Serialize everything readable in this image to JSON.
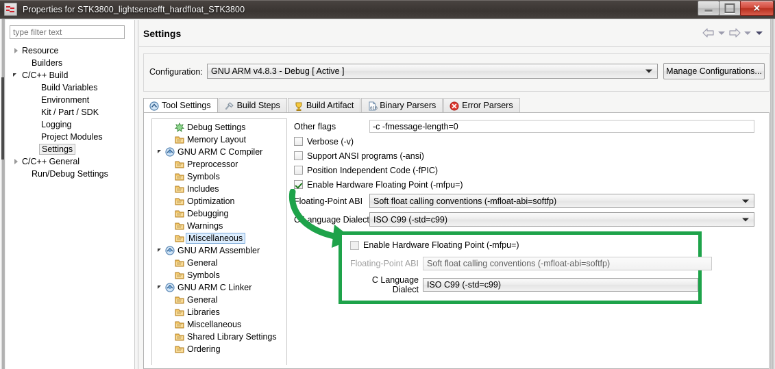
{
  "window": {
    "title": "Properties for STK3800_lightsensefft_hardfloat_STK3800",
    "app_icon": "simplicity-studio-icon",
    "minimize_label": "",
    "maximize_label": "",
    "close_label": "✕"
  },
  "sidebar": {
    "filter_placeholder": "type filter text",
    "filter_value": "",
    "items": [
      {
        "label": "Resource",
        "indent": 0,
        "twist": "collapsed",
        "selected": false
      },
      {
        "label": "Builders",
        "indent": 1,
        "twist": "none",
        "selected": false
      },
      {
        "label": "C/C++ Build",
        "indent": 0,
        "twist": "expanded",
        "selected": false
      },
      {
        "label": "Build Variables",
        "indent": 2,
        "twist": "none",
        "selected": false
      },
      {
        "label": "Environment",
        "indent": 2,
        "twist": "none",
        "selected": false
      },
      {
        "label": "Kit / Part / SDK",
        "indent": 2,
        "twist": "none",
        "selected": false
      },
      {
        "label": "Logging",
        "indent": 2,
        "twist": "none",
        "selected": false
      },
      {
        "label": "Project Modules",
        "indent": 2,
        "twist": "none",
        "selected": false
      },
      {
        "label": "Settings",
        "indent": 2,
        "twist": "none",
        "selected": true
      },
      {
        "label": "C/C++ General",
        "indent": 0,
        "twist": "collapsed",
        "selected": false
      },
      {
        "label": "Run/Debug Settings",
        "indent": 1,
        "twist": "none",
        "selected": false
      }
    ]
  },
  "content": {
    "page_title": "Settings",
    "nav": {
      "back_icon": "back-arrow-icon",
      "back_menu_icon": "chevron-down-icon",
      "forward_icon": "forward-arrow-icon",
      "forward_menu_icon": "chevron-down-icon",
      "view_menu_icon": "chevron-down-icon"
    },
    "configuration": {
      "label": "Configuration:",
      "value": "GNU ARM v4.8.3 - Debug  [ Active ]",
      "manage_button": "Manage Configurations..."
    },
    "tabs": [
      {
        "label": "Tool Settings",
        "icon": "tool-settings-icon",
        "active": true
      },
      {
        "label": "Build Steps",
        "icon": "build-steps-icon",
        "active": false
      },
      {
        "label": "Build Artifact",
        "icon": "build-artifact-icon",
        "active": false
      },
      {
        "label": "Binary Parsers",
        "icon": "binary-parsers-icon",
        "active": false
      },
      {
        "label": "Error Parsers",
        "icon": "error-parsers-icon",
        "active": false
      }
    ],
    "tool_tree": [
      {
        "label": "Debug Settings",
        "indent": 1,
        "twist": "none",
        "icon": "debug-icon",
        "selected": false
      },
      {
        "label": "Memory Layout",
        "indent": 1,
        "twist": "none",
        "icon": "folder-icon",
        "selected": false
      },
      {
        "label": "GNU ARM C Compiler",
        "indent": 0,
        "twist": "expanded",
        "icon": "tool-icon",
        "selected": false
      },
      {
        "label": "Preprocessor",
        "indent": 1,
        "twist": "none",
        "icon": "folder-icon",
        "selected": false
      },
      {
        "label": "Symbols",
        "indent": 1,
        "twist": "none",
        "icon": "folder-icon",
        "selected": false
      },
      {
        "label": "Includes",
        "indent": 1,
        "twist": "none",
        "icon": "folder-icon",
        "selected": false
      },
      {
        "label": "Optimization",
        "indent": 1,
        "twist": "none",
        "icon": "folder-icon",
        "selected": false
      },
      {
        "label": "Debugging",
        "indent": 1,
        "twist": "none",
        "icon": "folder-icon",
        "selected": false
      },
      {
        "label": "Warnings",
        "indent": 1,
        "twist": "none",
        "icon": "folder-icon",
        "selected": false
      },
      {
        "label": "Miscellaneous",
        "indent": 1,
        "twist": "none",
        "icon": "folder-icon",
        "selected": true
      },
      {
        "label": "GNU ARM Assembler",
        "indent": 0,
        "twist": "expanded",
        "icon": "tool-icon",
        "selected": false
      },
      {
        "label": "General",
        "indent": 1,
        "twist": "none",
        "icon": "folder-icon",
        "selected": false
      },
      {
        "label": "Symbols",
        "indent": 1,
        "twist": "none",
        "icon": "folder-icon",
        "selected": false
      },
      {
        "label": "GNU ARM C Linker",
        "indent": 0,
        "twist": "expanded",
        "icon": "tool-icon",
        "selected": false
      },
      {
        "label": "General",
        "indent": 1,
        "twist": "none",
        "icon": "folder-icon",
        "selected": false
      },
      {
        "label": "Libraries",
        "indent": 1,
        "twist": "none",
        "icon": "folder-icon",
        "selected": false
      },
      {
        "label": "Miscellaneous",
        "indent": 1,
        "twist": "none",
        "icon": "folder-icon",
        "selected": false
      },
      {
        "label": "Shared Library Settings",
        "indent": 1,
        "twist": "none",
        "icon": "folder-icon",
        "selected": false
      },
      {
        "label": "Ordering",
        "indent": 1,
        "twist": "none",
        "icon": "folder-icon",
        "selected": false
      }
    ],
    "settings": {
      "other_flags_label": "Other flags",
      "other_flags_value": "-c -fmessage-length=0",
      "checkboxes": [
        {
          "label": "Verbose (-v)",
          "checked": false
        },
        {
          "label": "Support ANSI programs (-ansi)",
          "checked": false
        },
        {
          "label": "Position Independent Code (-fPIC)",
          "checked": false
        },
        {
          "label": "Enable Hardware Floating Point (-mfpu=)",
          "checked": true
        }
      ],
      "combos": [
        {
          "label": "Floating-Point ABI",
          "value": "Soft float calling conventions (-mfloat-abi=softfp)"
        },
        {
          "label": "C Language Dialect",
          "value": "ISO C99 (-std=c99)"
        }
      ]
    }
  },
  "callout": {
    "border_color": "#1ea34a",
    "arrow_color": "#1ea34a",
    "arrow_icon": "curved-green-arrow-icon",
    "checkbox_label": "Enable Hardware Floating Point (-mfpu=)",
    "checkbox_checked": false,
    "rows": [
      {
        "label": "Floating-Point ABI",
        "value": "Soft float calling conventions (-mfloat-abi=softfp)",
        "disabled": true
      },
      {
        "label": "C Language Dialect",
        "value": "ISO C99 (-std=c99)",
        "disabled": false
      }
    ]
  }
}
